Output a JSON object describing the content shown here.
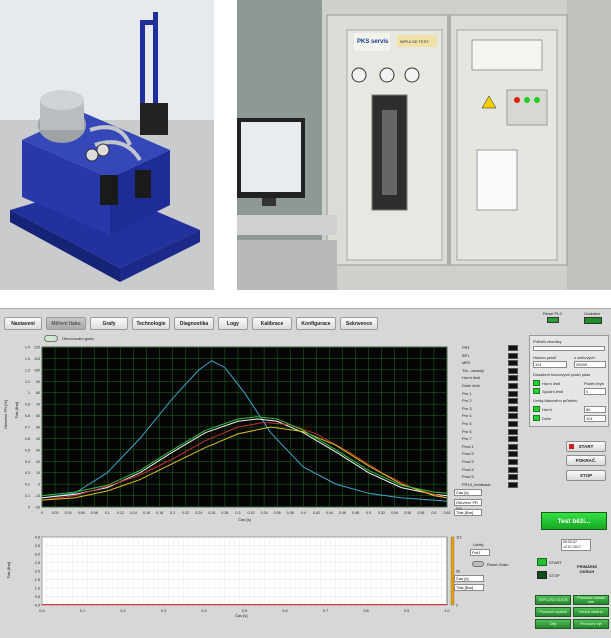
{
  "photo_right": {
    "logo_text": "PKS servis",
    "panel_label": "IMPULSE TEST"
  },
  "hmi": {
    "tabs": [
      "Nastavení",
      "Měření tlaku",
      "Grafy",
      "Technologie",
      "Diagnostika",
      "Logy",
      "Kalibrace",
      "Konfigurace",
      "Seknvence"
    ],
    "reset_plc": "Reset PLC",
    "ovladani": "Ovládání",
    "refresh_label": "Obnovování grafu",
    "y_label": "Otevření PR [%]",
    "y_label2": "Tlak [Bar]",
    "x_label": "Čas [s]",
    "legend": [
      "PR1",
      "BP1",
      "MR2",
      "Tla - zadaný",
      "Horní limit",
      "Dolní limit",
      "Pro 1",
      "Pro 2",
      "Pro 3",
      "Pro 4",
      "Pro 5",
      "Pro 6",
      "Pro 7",
      "Prod 1",
      "Prod 2",
      "Prod 3",
      "Prod 4",
      "Prod 5",
      "PR10_feedback"
    ],
    "cursor_fields": [
      "Čas [s]",
      "Otevření PR [%]",
      "Tlak [Bar]"
    ],
    "bottom_fields": [
      "Čas [s]",
      "Tlak [Bar]"
    ],
    "reset_grafu": "Reset Grafu",
    "limit_label": "Limity",
    "limit_value": "Prd1",
    "right_panel": {
      "prubeh": "Průběh zkoušky",
      "hotovo": "Hotovo pulsů",
      "z_celkovych": "z celkových",
      "hotovo_val": "114",
      "celk_val": "25000",
      "dosazeni": "Dosažení koncových pulsů plstu",
      "horni_limit": "Horní limit",
      "spodni_limit": "Spodní limit",
      "pocet_chyb": "Počet chyb",
      "pocet_chyb_val": "0",
      "limity": "Limity tlakového průběhu",
      "horni": "Horní",
      "horni_val": "80",
      "dolni": "Dolní",
      "dolni_val": "113"
    },
    "start": "START",
    "pokrac": "POKRAČ.",
    "stop": "STOP",
    "test_status": "Test běží...",
    "date_time": "09:02:47\n12.07.2017",
    "start2": "START",
    "stop2": "STOP",
    "primarni": "PRIMÁRNÍ\nOKRUH",
    "bottom_buttons": [
      "TEPLOTA OLEJE",
      "Provozní rozsah\nvalv",
      "Provozní teplota",
      "Hrubá obrana",
      "Olej",
      "Provozní vyt"
    ]
  },
  "chart_data": {
    "type": "line",
    "top_chart": {
      "xlim": [
        0,
        0.62
      ],
      "ylim_left": [
        -20,
        120
      ],
      "ylim_right": [
        0,
        1.4
      ],
      "x_ticks": [
        "0",
        "0.02",
        "0.04",
        "0.06",
        "0.08",
        "0.1",
        "0.12",
        "0.14",
        "0.16",
        "0.18",
        "0.2",
        "0.22",
        "0.24",
        "0.26",
        "0.28",
        "0.3",
        "0.32",
        "0.34",
        "0.36",
        "0.38",
        "0.4",
        "0.42",
        "0.44",
        "0.46",
        "0.48",
        "0.5",
        "0.52",
        "0.54",
        "0.56",
        "0.58",
        "0.6",
        "0.62"
      ],
      "y_ticks_left": [
        "120",
        "110",
        "100",
        "90",
        "80",
        "70",
        "60",
        "50",
        "40",
        "30",
        "20",
        "10",
        "0",
        "-10",
        "-20"
      ],
      "y_ticks_right": [
        "1.4",
        "1.3",
        "1.2",
        "1.1",
        "1",
        "0.9",
        "0.8",
        "0.7",
        "0.6",
        "0.5",
        "0.4",
        "0.3",
        "0.2",
        "0.1",
        "0"
      ],
      "series": [
        {
          "color": "#3aa6c8",
          "x": [
            0,
            0.05,
            0.1,
            0.15,
            0.2,
            0.24,
            0.26,
            0.28,
            0.31,
            0.35,
            0.4,
            0.45,
            0.5,
            0.55,
            0.6,
            0.62
          ],
          "y": [
            -12,
            -8,
            10,
            40,
            75,
            100,
            108,
            102,
            80,
            45,
            15,
            0,
            -8,
            -12,
            -14,
            -15
          ]
        },
        {
          "color": "#f5f5f5",
          "x": [
            0,
            0.05,
            0.1,
            0.15,
            0.2,
            0.25,
            0.3,
            0.33,
            0.36,
            0.4,
            0.45,
            0.5,
            0.55,
            0.6,
            0.62
          ],
          "y": [
            -12,
            -9,
            -3,
            10,
            28,
            45,
            55,
            57,
            55,
            45,
            28,
            10,
            -3,
            -9,
            -10
          ]
        },
        {
          "color": "#c03030",
          "x": [
            0,
            0.05,
            0.1,
            0.15,
            0.2,
            0.25,
            0.3,
            0.34,
            0.38,
            0.42,
            0.47,
            0.52,
            0.57,
            0.62
          ],
          "y": [
            -14,
            -10,
            -2,
            8,
            22,
            38,
            50,
            54,
            52,
            44,
            28,
            10,
            -4,
            -12
          ]
        },
        {
          "color": "#d8c020",
          "x": [
            0,
            0.05,
            0.1,
            0.15,
            0.2,
            0.25,
            0.3,
            0.35,
            0.4,
            0.45,
            0.5,
            0.55,
            0.6,
            0.62
          ],
          "y": [
            -14,
            -12,
            -6,
            4,
            18,
            32,
            44,
            50,
            46,
            34,
            16,
            0,
            -10,
            -12
          ]
        },
        {
          "color": "#30c040",
          "x": [
            0,
            0.05,
            0.1,
            0.15,
            0.2,
            0.25,
            0.3,
            0.33,
            0.36,
            0.4,
            0.45,
            0.5,
            0.55,
            0.6,
            0.62
          ],
          "y": [
            -10,
            -7,
            -1,
            12,
            30,
            47,
            57,
            59,
            57,
            47,
            30,
            12,
            -1,
            -7,
            -8
          ]
        }
      ]
    },
    "bottom_chart": {
      "xlim": [
        0,
        1
      ],
      "ylim": [
        0,
        4
      ],
      "x_ticks": [
        "0.0",
        "0.1",
        "0.2",
        "0.3",
        "0.4",
        "0.5",
        "0.6",
        "0.7",
        "0.8",
        "0.9",
        "1.0"
      ],
      "y_ticks": [
        "4.0",
        "3.5",
        "3.0",
        "2.5",
        "2.0",
        "1.5",
        "1.0",
        "0.5",
        "0.0"
      ],
      "right_ticks": [
        "112",
        "56",
        "0"
      ],
      "y_label": "Tlak [Bar]",
      "x_label": "Čas [s]"
    }
  }
}
